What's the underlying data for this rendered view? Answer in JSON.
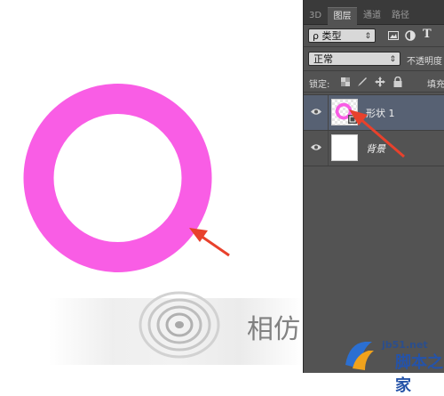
{
  "canvas": {
    "ring_color": "#f95de5",
    "arrow_color": "#e8412c",
    "watermark_text": "相仿"
  },
  "panel": {
    "tabs": [
      {
        "label": "3D",
        "active": false
      },
      {
        "label": "图层",
        "active": true
      },
      {
        "label": "通道",
        "active": false
      },
      {
        "label": "路径",
        "active": false
      }
    ],
    "filter": {
      "search_symbol": "ρ",
      "label": "类型",
      "icons": [
        "image-filter-icon",
        "adjustment-filter-icon",
        "type-filter-icon"
      ],
      "type_icon_text": "T"
    },
    "blend_mode": "正常",
    "opacity_label": "不透明度",
    "lock_label": "锁定:",
    "fill_label": "填充",
    "layers": [
      {
        "name": "形状 1",
        "selected": true,
        "visible": true,
        "type": "shape"
      },
      {
        "name": "背景",
        "selected": false,
        "visible": true,
        "type": "background"
      }
    ]
  },
  "watermark": {
    "url": "jb51.net",
    "name": "脚本之家"
  }
}
